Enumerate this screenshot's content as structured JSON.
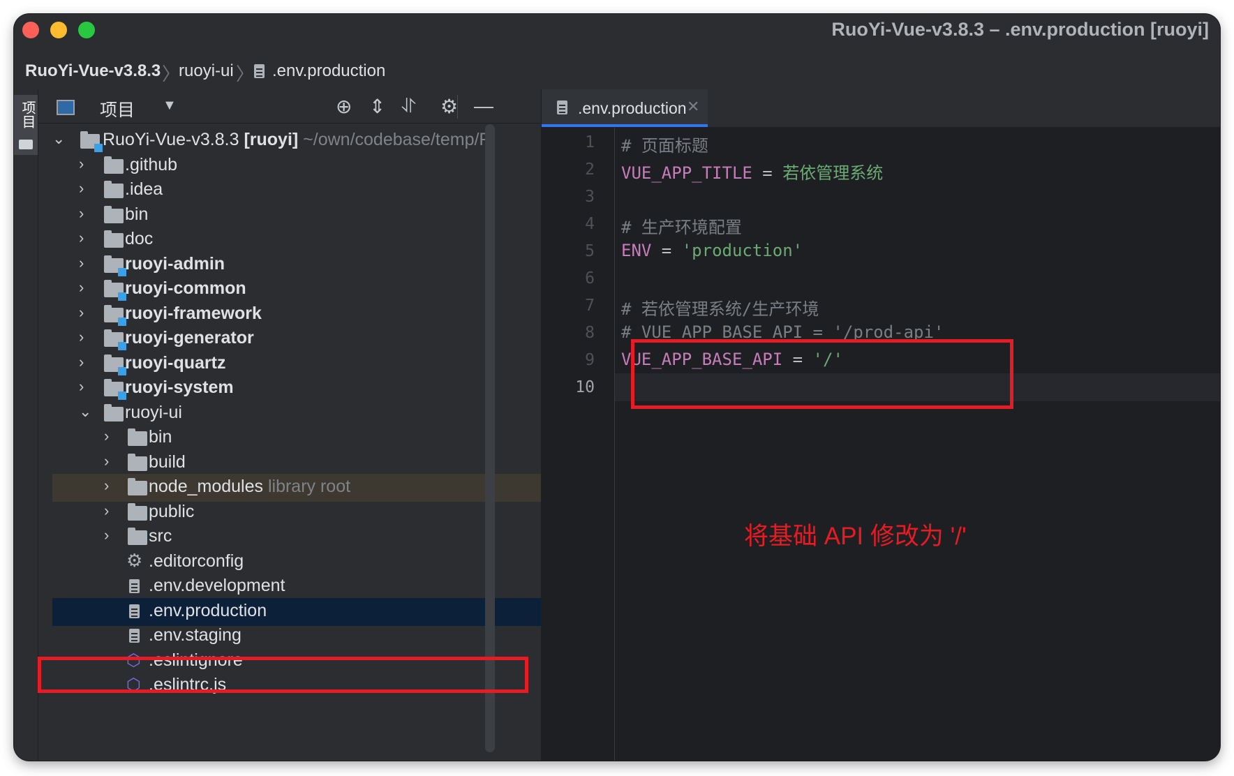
{
  "window": {
    "title": "RuoYi-Vue-v3.8.3 – .env.production [ruoyi]"
  },
  "breadcrumb": {
    "items": [
      "RuoYi-Vue-v3.8.3",
      "ruoyi-ui",
      ".env.production"
    ]
  },
  "tool_stripe": {
    "project_label": "项目"
  },
  "project_panel": {
    "title": "项目",
    "tree": [
      {
        "label": "RuoYi-Vue-v3.8.3",
        "module": "[ruoyi]",
        "path": "~/own/codebase/temp/R"
      },
      {
        "label": ".github"
      },
      {
        "label": ".idea"
      },
      {
        "label": "bin"
      },
      {
        "label": "doc"
      },
      {
        "label": "ruoyi-admin"
      },
      {
        "label": "ruoyi-common"
      },
      {
        "label": "ruoyi-framework"
      },
      {
        "label": "ruoyi-generator"
      },
      {
        "label": "ruoyi-quartz"
      },
      {
        "label": "ruoyi-system"
      },
      {
        "label": "ruoyi-ui"
      },
      {
        "label": "bin"
      },
      {
        "label": "build"
      },
      {
        "label": "node_modules",
        "note": "library root"
      },
      {
        "label": "public"
      },
      {
        "label": "src"
      },
      {
        "label": ".editorconfig"
      },
      {
        "label": ".env.development"
      },
      {
        "label": ".env.production"
      },
      {
        "label": ".env.staging"
      },
      {
        "label": ".eslintignore"
      },
      {
        "label": ".eslintrc.js"
      }
    ]
  },
  "editor": {
    "tab_label": ".env.production",
    "lines": [
      {
        "n": "1",
        "comment": "# 页面标题"
      },
      {
        "n": "2",
        "key": "VUE_APP_TITLE",
        "op": " = ",
        "value": "若依管理系统"
      },
      {
        "n": "3"
      },
      {
        "n": "4",
        "comment": "# 生产环境配置"
      },
      {
        "n": "5",
        "key": "ENV",
        "op": " = ",
        "value": "'production'"
      },
      {
        "n": "6"
      },
      {
        "n": "7",
        "comment": "# 若依管理系统/生产环境"
      },
      {
        "n": "8",
        "comment": "# VUE_APP_BASE_API = '/prod-api'"
      },
      {
        "n": "9",
        "key": "VUE_APP_BASE_API",
        "op": " = ",
        "value": "'/'"
      },
      {
        "n": "10"
      }
    ]
  },
  "annotation": {
    "text": "将基础 API 修改为 '/'",
    "color": "#e51c23"
  },
  "colors": {
    "accent": "#3574f0",
    "selection": "#0d2039",
    "library_row": "#3d3830"
  }
}
